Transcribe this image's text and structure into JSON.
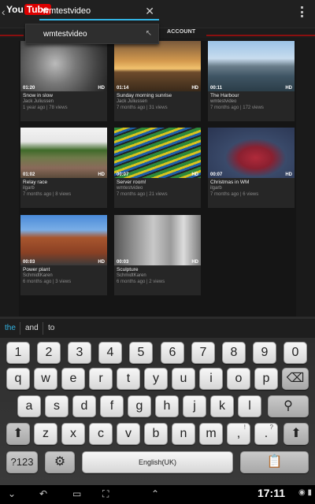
{
  "header": {
    "back_icon": "chevron-left-icon",
    "logo_you": "You",
    "logo_tube": "Tube",
    "search_value": "wmtestvideo",
    "clear_icon": "close-icon",
    "account_tab": "ACCOUNT"
  },
  "suggestion": {
    "text": "wmtestvideo",
    "arrow_icon": "arrow-up-left-icon"
  },
  "videos": [
    {
      "time": "01:20",
      "hd": "HD",
      "title": "Snow in slow",
      "author": "Jack Juliussen",
      "meta": "1 year ago | 78 views"
    },
    {
      "time": "01:14",
      "hd": "HD",
      "title": "Sunday morning sunrise",
      "author": "Jack Juliussen",
      "meta": "7 months ago | 31 views"
    },
    {
      "time": "00:11",
      "hd": "HD",
      "title": "The Harbour",
      "author": "wmtestvideo",
      "meta": "7 months ago | 172 views"
    },
    {
      "time": "01:02",
      "hd": "HD",
      "title": "Relay race",
      "author": "ilgarb",
      "meta": "7 months ago | 8 views"
    },
    {
      "time": "00:07",
      "hd": "HD",
      "title": "Server room!",
      "author": "wmtestvideo",
      "meta": "7 months ago | 21 views"
    },
    {
      "time": "00:07",
      "hd": "HD",
      "title": "Christmas in WM",
      "author": "ilgarb",
      "meta": "7 months ago | 6 views"
    },
    {
      "time": "00:03",
      "hd": "HD",
      "title": "Power plant",
      "author": "SchmidtKaren",
      "meta": "6 months ago | 3 views"
    },
    {
      "time": "00:03",
      "hd": "HD",
      "title": "Sculpture",
      "author": "SchmidtKaren",
      "meta": "6 months ago | 2 views"
    }
  ],
  "keyboard": {
    "suggestions": [
      "the",
      "and",
      "to"
    ],
    "row1": [
      "1",
      "2",
      "3",
      "4",
      "5",
      "6",
      "7",
      "8",
      "9",
      "0"
    ],
    "row2": [
      "q",
      "w",
      "e",
      "r",
      "t",
      "y",
      "u",
      "i",
      "o",
      "p"
    ],
    "row3": [
      "a",
      "s",
      "d",
      "f",
      "g",
      "h",
      "j",
      "k",
      "l"
    ],
    "row4": [
      "z",
      "x",
      "c",
      "v",
      "b",
      "n",
      "m"
    ],
    "comma_key": ",",
    "comma_sup": "!",
    "period_key": ".",
    "period_sup": "?",
    "symbols_key": "?123",
    "space_label": "English(UK)",
    "backspace_icon": "backspace-icon",
    "search_icon": "search-icon",
    "shift_icon": "shift-icon",
    "settings_icon": "gear-icon",
    "clipboard_icon": "clipboard-icon"
  },
  "status_bar": {
    "time": "17:11"
  }
}
